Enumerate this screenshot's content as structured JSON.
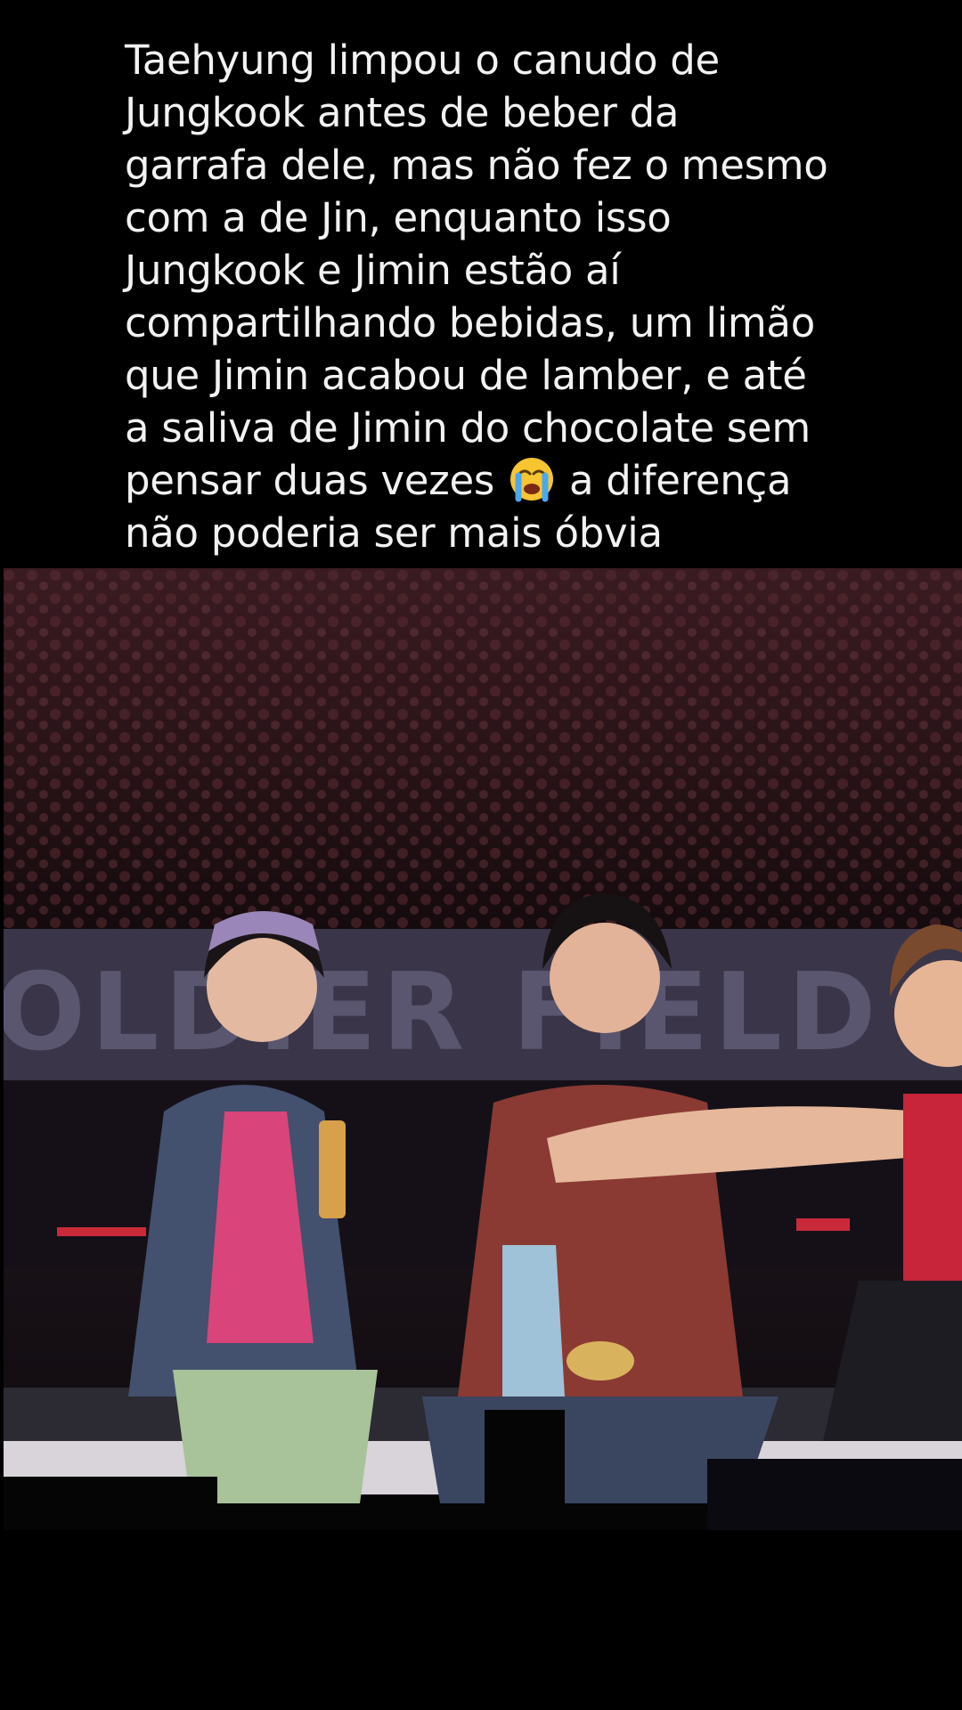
{
  "post": {
    "caption_lines": [
      "Taehyung limpou o canudo de",
      "Jungkook antes de beber da",
      "garrafa dele, mas não fez o mesmo",
      "com a de Jin, enquanto isso",
      "Jungkook e Jimin estão aí",
      "compartilhando bebidas, um limão",
      "que Jimin acabou de lamber, e até",
      "a saliva de Jimin do chocolate sem",
      "pensar duas vezes",
      "a diferença",
      "não poderia ser mais óbvia"
    ],
    "emoji": "loudly-crying-face-icon"
  },
  "video": {
    "stage_banner_text": "OLDIER FIELD"
  },
  "colors": {
    "background": "#000000",
    "caption_text": "#f2f2f2",
    "stage_banner": "#3a3548"
  }
}
